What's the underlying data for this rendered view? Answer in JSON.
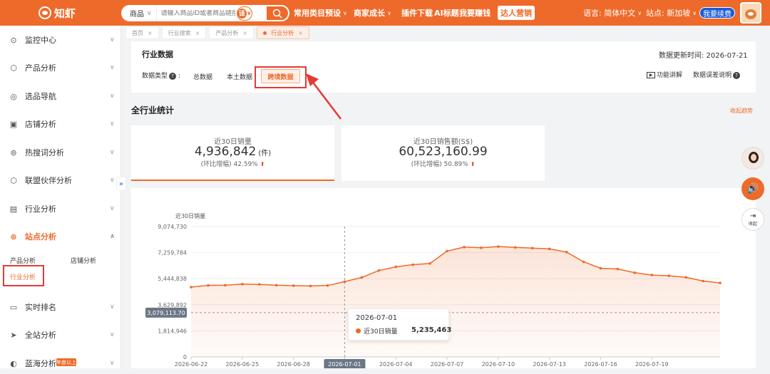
{
  "topbar": {
    "logo_text": "知虾",
    "search": {
      "category": "商品",
      "placeholder": "请输入商品ID或者商品链接",
      "translate_label": "译"
    },
    "nav": [
      {
        "label": "常用类目预设",
        "has_dropdown": true
      },
      {
        "label": "商家成长",
        "has_dropdown": true
      },
      {
        "label": "插件下载",
        "has_dropdown": false
      },
      {
        "label": "AI标题",
        "has_dropdown": false
      },
      {
        "label": "我要赚钱",
        "has_dropdown": false
      }
    ],
    "vip_button": "达人营销",
    "language": "语言: 简体中文",
    "site": "站点: 新加坡",
    "renew_button": "我要续费"
  },
  "sidebar": {
    "items": [
      {
        "label": "监控中心",
        "icon": "location-icon"
      },
      {
        "label": "产品分析",
        "icon": "box-icon"
      },
      {
        "label": "选品导航",
        "icon": "compass-icon"
      },
      {
        "label": "店铺分析",
        "icon": "store-icon"
      },
      {
        "label": "热搜词分析",
        "icon": "hot-search-icon"
      },
      {
        "label": "联盟伙伴分析",
        "icon": "partner-icon"
      },
      {
        "label": "行业分析",
        "icon": "industry-icon"
      },
      {
        "label": "站点分析",
        "icon": "site-icon",
        "active": true
      },
      {
        "label": "实时排名",
        "icon": "ranking-icon"
      },
      {
        "label": "全站分析",
        "icon": "send-icon"
      },
      {
        "label": "蓝海分析",
        "icon": "ocean-icon",
        "badge": "年度以上"
      }
    ],
    "sub_items": [
      "产品分析",
      "店铺分析",
      "行业分析"
    ]
  },
  "tabs": [
    {
      "label": "首页",
      "active": false
    },
    {
      "label": "行业搜索",
      "active": false
    },
    {
      "label": "产品分析",
      "active": false
    },
    {
      "label": "行业分析",
      "active": true
    }
  ],
  "industry_data": {
    "title": "行业数据",
    "update_time": "数据更新时间: 2026-07-21",
    "type_label": "数据类型",
    "types": [
      "总数据",
      "本土数据",
      "跨境数据"
    ],
    "selected_type": "跨境数据",
    "feature_link": "功能讲解",
    "error_link": "数据误差说明"
  },
  "stats": {
    "title": "全行业统计",
    "collapse_link": "收起趋势",
    "kpis": [
      {
        "label": "近30日销量",
        "value": "4,936,842",
        "unit": "(件)",
        "growth_label": "(环比增幅)",
        "growth": "42.59%"
      },
      {
        "label": "近30日销售额(S$)",
        "value": "60,523,160.99",
        "unit": "",
        "growth_label": "(环比增幅)",
        "growth": "50.89%"
      }
    ]
  },
  "chart_data": {
    "type": "area",
    "ylabel": "近30日销量",
    "ylim": [
      0,
      9074730
    ],
    "yticks": [
      "9,074,730",
      "7,259,784",
      "5,444,838",
      "3,629,892",
      "1,814,946",
      "0"
    ],
    "ytick_values": [
      9074730,
      7259784,
      5444838,
      3629892,
      1814946,
      0
    ],
    "xticks": [
      "2026-06-22",
      "2026-06-25",
      "2026-06-28",
      "2026-07-01",
      "2026-07-04",
      "2026-07-07",
      "2026-07-10",
      "2026-07-13",
      "2026-07-16",
      "2026-07-19"
    ],
    "x": [
      "2026-06-22",
      "2026-06-23",
      "2026-06-24",
      "2026-06-25",
      "2026-06-26",
      "2026-06-27",
      "2026-06-28",
      "2026-06-29",
      "2026-06-30",
      "2026-07-01",
      "2026-07-02",
      "2026-07-03",
      "2026-07-04",
      "2026-07-05",
      "2026-07-06",
      "2026-07-07",
      "2026-07-08",
      "2026-07-09",
      "2026-07-10",
      "2026-07-11",
      "2026-07-12",
      "2026-07-13",
      "2026-07-14",
      "2026-07-15",
      "2026-07-16",
      "2026-07-17",
      "2026-07-18",
      "2026-07-19",
      "2026-07-20"
    ],
    "series": [
      {
        "name": "近30日销量",
        "values": [
          4860000,
          4980000,
          4990000,
          5070000,
          5050000,
          4990000,
          4960000,
          4940000,
          4970000,
          5235463,
          5530000,
          6010000,
          6270000,
          6420000,
          6500000,
          7370000,
          7640000,
          7600000,
          7680000,
          7620000,
          7570000,
          7520000,
          7300000,
          6620000,
          6170000,
          6120000,
          5860000,
          5700000,
          5650000,
          5540000,
          5280000,
          5150000
        ],
        "color": "#ee6a2a"
      }
    ],
    "crosshair": {
      "x_label": "2026-07-01",
      "y_label": "3,079,113.70"
    },
    "tooltip": {
      "date": "2026-07-01",
      "series": "近30日销量",
      "value": "5,235,463"
    }
  },
  "float": {
    "collapse_label": "收起"
  }
}
